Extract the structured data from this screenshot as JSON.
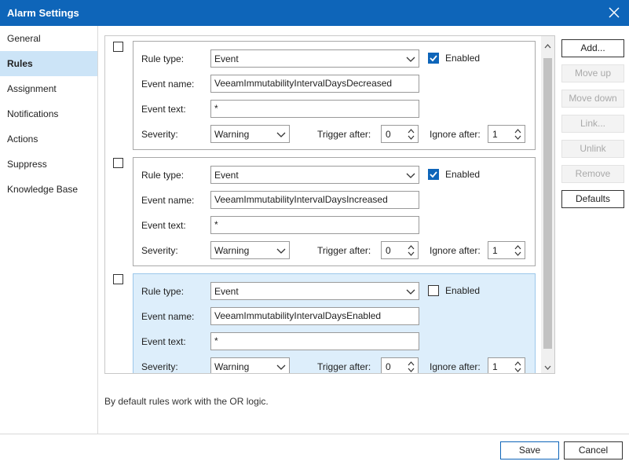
{
  "window": {
    "title": "Alarm Settings"
  },
  "nav": {
    "items": [
      {
        "label": "General"
      },
      {
        "label": "Rules"
      },
      {
        "label": "Assignment"
      },
      {
        "label": "Notifications"
      },
      {
        "label": "Actions"
      },
      {
        "label": "Suppress"
      },
      {
        "label": "Knowledge Base"
      }
    ],
    "active": "Rules"
  },
  "labels": {
    "rule_type": "Rule type:",
    "event_name": "Event name:",
    "event_text": "Event text:",
    "severity": "Severity:",
    "trigger_after": "Trigger after:",
    "ignore_after": "Ignore after:",
    "enabled": "Enabled"
  },
  "rules": [
    {
      "rule_type": "Event",
      "enabled": true,
      "event_name": "VeeamImmutabilityIntervalDaysDecreased",
      "event_text": "*",
      "severity": "Warning",
      "trigger_after": "0",
      "ignore_after": "1"
    },
    {
      "rule_type": "Event",
      "enabled": true,
      "event_name": "VeeamImmutabilityIntervalDaysIncreased",
      "event_text": "*",
      "severity": "Warning",
      "trigger_after": "0",
      "ignore_after": "1"
    },
    {
      "rule_type": "Event",
      "enabled": false,
      "event_name": "VeeamImmutabilityIntervalDaysEnabled",
      "event_text": "*",
      "severity": "Warning",
      "trigger_after": "0",
      "ignore_after": "1"
    }
  ],
  "side_buttons": {
    "add": "Add...",
    "move_up": "Move up",
    "move_down": "Move down",
    "link": "Link...",
    "unlink": "Unlink",
    "remove": "Remove",
    "defaults": "Defaults"
  },
  "info_text": "By default rules work with the OR logic.",
  "footer": {
    "save": "Save",
    "cancel": "Cancel"
  },
  "colors": {
    "accent": "#0e65b9",
    "selected_nav": "#cce4f7",
    "selected_rule": "#ddeefb"
  },
  "icons": {
    "close": "close-icon",
    "dropdown": "chevron-down-icon",
    "spin_up": "chevron-up-icon",
    "spin_down": "chevron-down-icon",
    "check": "checkmark-icon"
  }
}
